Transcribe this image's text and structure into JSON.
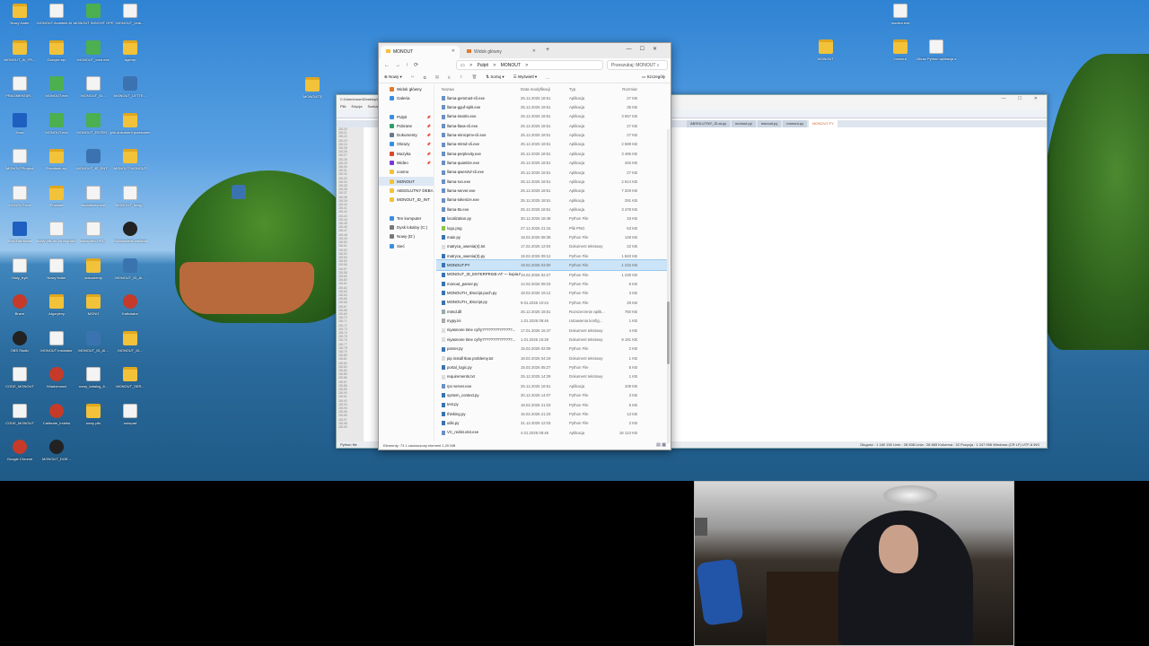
{
  "desktop_icons": [
    {
      "label": "Nowy folder",
      "type": "folder"
    },
    {
      "label": "MONOUT Architekt AI ...",
      "type": "doc"
    },
    {
      "label": "MONOUT INSIGHT OPRO...",
      "type": "green"
    },
    {
      "label": "MONOUT_Unik...",
      "type": "doc"
    },
    {
      "label": "MONOUT_AI_FR...",
      "type": "folder"
    },
    {
      "label": "Dolsyte.zip",
      "type": "folder"
    },
    {
      "label": "MONOUT_core.exe",
      "type": "green"
    },
    {
      "label": "agenty",
      "type": "folder"
    },
    {
      "label": "FRAGMENTAR...",
      "type": "doc"
    },
    {
      "label": "MONOUT.exe",
      "type": "green"
    },
    {
      "label": "MONOUT_ID...",
      "type": "doc"
    },
    {
      "label": "MONOUT_LETTE...",
      "type": "py"
    },
    {
      "label": "Kosz",
      "type": "blue"
    },
    {
      "label": "MONOUT.exe",
      "type": "green"
    },
    {
      "label": "MONOUT_ENTER...",
      "type": "green"
    },
    {
      "label": "plik dokument przesuniecie",
      "type": "folder"
    },
    {
      "label": "MONOUTProject",
      "type": "doc"
    },
    {
      "label": "Frantisek.zip",
      "type": "folder"
    },
    {
      "label": "MONOUT_ID_ENT...",
      "type": "py"
    },
    {
      "label": "MONOUT MONOUT",
      "type": "folder"
    },
    {
      "label": "MONOUT.exe",
      "type": "doc"
    },
    {
      "label": "Fraktale",
      "type": "folder"
    },
    {
      "label": "dodatkowy.exe",
      "type": "doc"
    },
    {
      "label": "MONOUT_Imag...",
      "type": "doc"
    },
    {
      "label": "Stan Hardware",
      "type": "blue"
    },
    {
      "label": "nowy plik do zaprogramowania",
      "type": "doc"
    },
    {
      "label": "instagram-HFA...",
      "type": "doc"
    },
    {
      "label": "Rozwiazanie zadania",
      "type": "dark"
    },
    {
      "label": "Maly_tryb",
      "type": "doc"
    },
    {
      "label": "Nowy folder",
      "type": "doc"
    },
    {
      "label": "dokumenty",
      "type": "folder"
    },
    {
      "label": "MONOUT_ID_AI...",
      "type": "py"
    },
    {
      "label": "Brave",
      "type": "red"
    },
    {
      "label": "Algorytmy",
      "type": "folder"
    },
    {
      "label": "MONO",
      "type": "folder"
    },
    {
      "label": "Kalkulator",
      "type": "red"
    },
    {
      "label": "OBS Studio",
      "type": "dark"
    },
    {
      "label": "MONOUT Instalator",
      "type": "doc"
    },
    {
      "label": "MONOUT_ID_AI...",
      "type": "py"
    },
    {
      "label": "MONOUT_ID...",
      "type": "folder"
    },
    {
      "label": "CODE_MONOUT",
      "type": "doc"
    },
    {
      "label": "Wiadomosci",
      "type": "red"
    },
    {
      "label": "nowy_katalog_8...",
      "type": "doc"
    },
    {
      "label": "MONOUT_SER...",
      "type": "folder"
    },
    {
      "label": "CODE_MONOUT",
      "type": "doc"
    },
    {
      "label": "Calibrate_Indeks",
      "type": "red"
    },
    {
      "label": "nowy plik",
      "type": "folder"
    },
    {
      "label": "notepad",
      "type": "doc"
    },
    {
      "label": "Google Chrome",
      "type": "red"
    },
    {
      "label": "MONOUT_DOE...",
      "type": "dark"
    }
  ],
  "right_icons": [
    {
      "label": "monitor.exe",
      "type": "doc"
    },
    {
      "label": "MONOUT",
      "type": "folder"
    },
    {
      "label": "monout",
      "type": "folder"
    },
    {
      "label": "Obraz Python aplikacja stacji",
      "type": "doc"
    },
    {
      "label": "MONOUT3",
      "type": "folder"
    },
    {
      "label": "",
      "type": "py"
    }
  ],
  "editor": {
    "title": "C:\\Users\\mon\\Desktop\\MONOUT\\MONOUT.PY - Notepad++",
    "menu": [
      "Plik",
      "Edycja",
      "Szukaj",
      "Widok",
      "Kodowanie",
      "Język",
      "Ustawienia",
      "Narzędzia",
      "Makra",
      "Uruchom",
      "Wtyczki",
      "Okno",
      "?"
    ],
    "tabs": [
      "ABSOLUTNY_ID.ai.py",
      "monout.py",
      "monout.py",
      "monout.py",
      "MONOUT.PY"
    ],
    "status_left": "Python file",
    "status_right": "Długość : 1 180 150    Linie : 28 838        Linia : 28 865    Kolumna : 32    Pozycja : 1 247 996    Windows (CR LF)    UTF-8         INS",
    "gutter": "28120\n28121\n28122\n28123\n28124\n28125\n28126\n28127\n28128\n28129\n28130\n28131\n28132\n28133\n28134\n28135\n28136\n28137\n28138\n28139\n28140\n28141\n28142\n28143\n28144\n28145\n28146\n28147\n28148\n28149\n28150\n28151\n28152\n28153\n28154\n28155\n28156\n28157\n28158\n28159\n28160\n28161\n28162\n28163\n28164\n28165\n28166\n28167\n28168\n28169\n28170\n28171\n28172\n28173\n28174\n28175\n28176\n28177\n28178\n28179\n28180\n28181\n28182\n28183\n28184\n28185\n28186\n28187\n28188\n28189\n28190\n28191\n28192\n28193\n28194\n28195\n28196\n28197\n28198\n28199"
  },
  "explorer": {
    "tab1": "MONOUT",
    "tab2": "Widok główny",
    "address": [
      "Pulpit",
      ">",
      "MONOUT",
      ">"
    ],
    "search_placeholder": "Przeszukaj: MONOUT",
    "commands": {
      "new": "Nowy",
      "sort": "Sortuj",
      "view": "Wyświetl",
      "more": "...",
      "details": "Szczegóły"
    },
    "sidebar": [
      {
        "label": "Widok główny",
        "color": "#e07a2f",
        "pin": false
      },
      {
        "label": "Galeria",
        "color": "#3a8ee0",
        "pin": false
      },
      {
        "label": "",
        "color": "transparent",
        "pin": false
      },
      {
        "label": "Pulpit",
        "color": "#3a8ee0",
        "pin": true
      },
      {
        "label": "Pobrane",
        "color": "#2f9e6a",
        "pin": true
      },
      {
        "label": "Dokumenty",
        "color": "#6a7a8a",
        "pin": true
      },
      {
        "label": "Obrazy",
        "color": "#3a8ee0",
        "pin": true
      },
      {
        "label": "Muzyka",
        "color": "#d9482b",
        "pin": true
      },
      {
        "label": "Wideo",
        "color": "#7a3ad9",
        "pin": true
      },
      {
        "label": "cosmo",
        "color": "#f2c23a",
        "pin": false
      },
      {
        "label": "MONOUT",
        "color": "#f2c23a",
        "pin": false,
        "sel": true
      },
      {
        "label": "ABSOLUTNY DEBA",
        "color": "#f2c23a",
        "pin": false
      },
      {
        "label": "MONOUT_ID_INT",
        "color": "#f2c23a",
        "pin": false
      },
      {
        "label": "",
        "color": "transparent",
        "pin": false
      },
      {
        "label": "Ten komputer",
        "color": "#3a8ee0",
        "pin": false
      },
      {
        "label": "Dysk lokalny (C:)",
        "color": "#777",
        "pin": false
      },
      {
        "label": "Nowy (D:)",
        "color": "#777",
        "pin": false
      },
      {
        "label": "Sieć",
        "color": "#3a8ee0",
        "pin": false
      }
    ],
    "columns": [
      "Nazwa",
      "Data modyfikacji",
      "Typ",
      "Rozmiar"
    ],
    "files": [
      {
        "name": "llama-gemma3-cli.exe",
        "date": "25.12.2025 18:51",
        "type": "Aplikacja",
        "size": "27 KB"
      },
      {
        "name": "llama-gguf-split.exe",
        "date": "25.12.2025 18:51",
        "type": "Aplikacja",
        "size": "35 KB"
      },
      {
        "name": "llama-imatrix.exe",
        "date": "25.12.2025 18:51",
        "type": "Aplikacja",
        "size": "3 657 KB"
      },
      {
        "name": "llama-llava-cli.exe",
        "date": "25.12.2025 18:51",
        "type": "Aplikacja",
        "size": "27 KB"
      },
      {
        "name": "llama-minicpmv-cli.exe",
        "date": "25.12.2025 18:51",
        "type": "Aplikacja",
        "size": "27 KB"
      },
      {
        "name": "llama-mtmd-cli.exe",
        "date": "25.12.2025 18:51",
        "type": "Aplikacja",
        "size": "2 588 KB"
      },
      {
        "name": "llama-perplexity.exe",
        "date": "25.12.2025 18:51",
        "type": "Aplikacja",
        "size": "3 496 KB"
      },
      {
        "name": "llama-quantize.exe",
        "date": "25.12.2025 18:51",
        "type": "Aplikacja",
        "size": "346 KB"
      },
      {
        "name": "llama-qwen2vl-cli.exe",
        "date": "25.12.2025 18:51",
        "type": "Aplikacja",
        "size": "27 KB"
      },
      {
        "name": "llama-run.exe",
        "date": "25.12.2025 18:51",
        "type": "Aplikacja",
        "size": "2 614 KB"
      },
      {
        "name": "llama-server.exe",
        "date": "25.12.2025 18:51",
        "type": "Aplikacja",
        "size": "7 329 KB"
      },
      {
        "name": "llama-tokenize.exe",
        "date": "25.12.2025 18:51",
        "type": "Aplikacja",
        "size": "291 KB"
      },
      {
        "name": "llama-tts.exe",
        "date": "25.12.2025 18:51",
        "type": "Aplikacja",
        "size": "3 478 KB"
      },
      {
        "name": "localization.py",
        "date": "30.12.2025 18:48",
        "type": "Python File",
        "size": "33 KB"
      },
      {
        "name": "logo.png",
        "date": "27.12.2025 21:15",
        "type": "Plik PNG",
        "size": "63 KB"
      },
      {
        "name": "main.py",
        "date": "18.02.2026 08:39",
        "type": "Python File",
        "size": "148 KB"
      },
      {
        "name": "matryca_owenia(4).txt",
        "date": "17.02.2026 12:04",
        "type": "Dokument tekstowy",
        "size": "22 KB"
      },
      {
        "name": "matryca_owenia(3).py",
        "date": "19.02.2026 09:12",
        "type": "Python File",
        "size": "1 840 KB"
      },
      {
        "name": "MONOUT.PY",
        "date": "19.02.2026 03:00",
        "type": "Python File",
        "size": "1 232 KB",
        "sel": true
      },
      {
        "name": "MONOUT_ID_ENTERPRISE-AT — kopia.PY",
        "date": "19.02.2026 02:27",
        "type": "Python File",
        "size": "1 230 KB"
      },
      {
        "name": "monout_parser.py",
        "date": "14.02.2026 09:23",
        "type": "Python File",
        "size": "6 KB"
      },
      {
        "name": "MONOUTH_IDscript.poch.py",
        "date": "18.02.2026 19:12",
        "type": "Python File",
        "size": "3 KB"
      },
      {
        "name": "MONOUTH_IDscript.py",
        "date": "9.01.2026 10:24",
        "type": "Python File",
        "size": "29 KB"
      },
      {
        "name": "mtmd.dll",
        "date": "25.12.2025 18:51",
        "type": "Rozszerzenie aplik...",
        "size": "760 KB"
      },
      {
        "name": "mypy.ini",
        "date": "1.01.2026 09:46",
        "type": "Ustawienia konfig...",
        "size": "1 KB"
      },
      {
        "name": "niyasnone time cyfry??????????????...",
        "date": "17.01.2026 16:47",
        "type": "Dokument tekstowy",
        "size": "4 KB"
      },
      {
        "name": "niyasnone time cyfry??????????????...",
        "date": "1.01.2026 16:28",
        "type": "Dokument tekstowy",
        "size": "8 191 KB"
      },
      {
        "name": "parser.py",
        "date": "15.02.2026 02:09",
        "type": "Python File",
        "size": "2 KB"
      },
      {
        "name": "pip install tkas problemy.txt",
        "date": "18.02.2026 04:19",
        "type": "Dokument tekstowy",
        "size": "1 KB"
      },
      {
        "name": "portal_logic.py",
        "date": "15.02.2026 05:27",
        "type": "Python File",
        "size": "5 KB"
      },
      {
        "name": "requirements.txt",
        "date": "25.12.2025 14:29",
        "type": "Dokument tekstowy",
        "size": "1 KB"
      },
      {
        "name": "rpc-server.exe",
        "date": "25.12.2025 18:51",
        "type": "Aplikacja",
        "size": "109 KB"
      },
      {
        "name": "system_context.py",
        "date": "30.12.2025 14:07",
        "type": "Python File",
        "size": "3 KB"
      },
      {
        "name": "test.py",
        "date": "18.02.2026 21:03",
        "type": "Python File",
        "size": "5 KB"
      },
      {
        "name": "thinking.py",
        "date": "15.02.2026 21:23",
        "type": "Python File",
        "size": "13 KB"
      },
      {
        "name": "utils.py",
        "date": "31.12.2025 12:03",
        "type": "Python File",
        "size": "2 KB"
      },
      {
        "name": "VC_redist.x64.exe",
        "date": "4.01.2026 09:46",
        "type": "Aplikacja",
        "size": "18 124 KB"
      }
    ],
    "status": "Elementy: 73    1 zaznaczony element  1,20 MB"
  }
}
